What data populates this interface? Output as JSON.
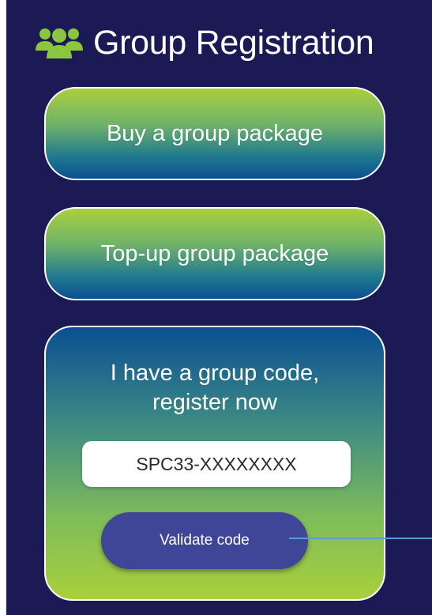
{
  "header": {
    "title": "Group Registration",
    "icon": "users-group-icon",
    "icon_color": "#8cc63f"
  },
  "buttons": {
    "buy_label": "Buy a group package",
    "topup_label": "Top-up group package"
  },
  "code_card": {
    "heading": "I have a group code, register now",
    "input_value": "SPC33-XXXXXXXX",
    "validate_label": "Validate code"
  },
  "colors": {
    "background": "#1c1a55",
    "gradient_top": "#a8cf3c",
    "gradient_bottom": "#0a4f92",
    "validate_button": "#3f4597",
    "pointer_line": "#5b9bd5"
  }
}
